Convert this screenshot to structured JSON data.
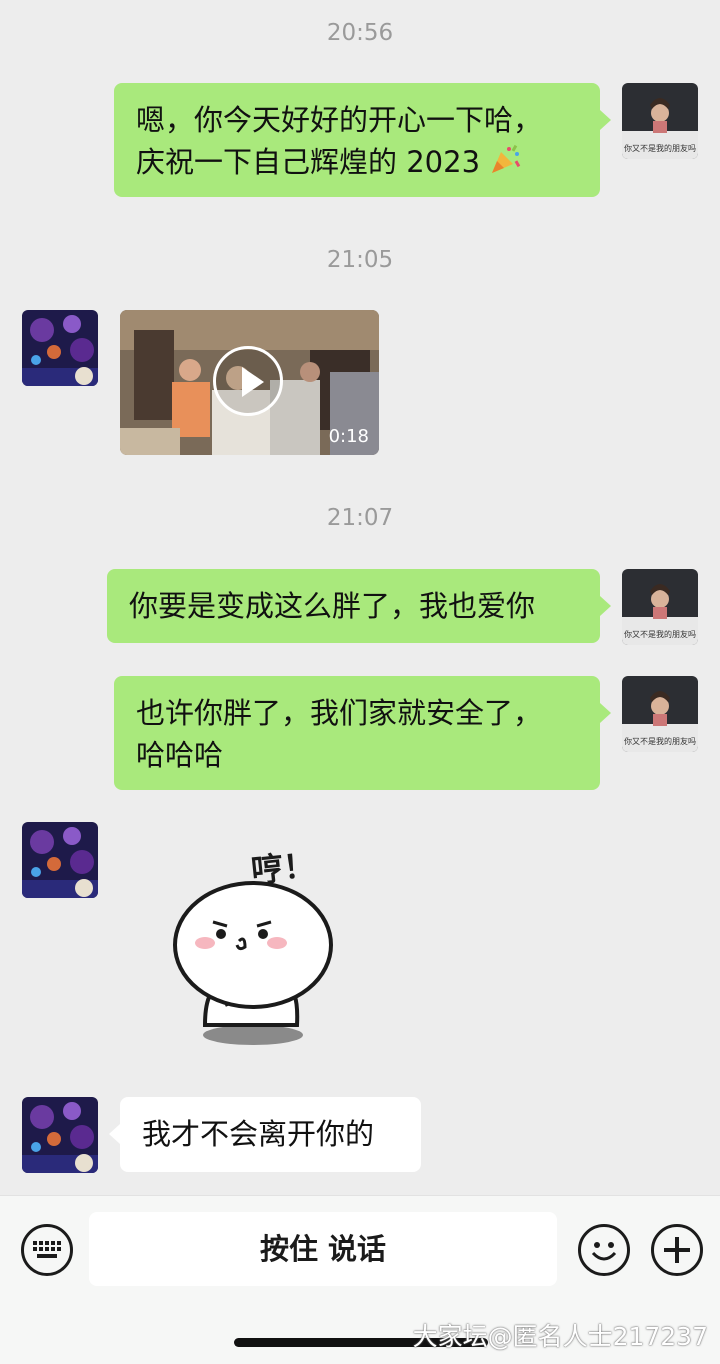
{
  "chat": {
    "messages": [
      {
        "type": "timestamp",
        "text": "20:56"
      },
      {
        "type": "text",
        "side": "right",
        "text_line1": "嗯，你今天好好的开心一下哈，",
        "text_line2": "庆祝一下自己辉煌的 2023",
        "emoji": "party-popper-icon",
        "avatar": "avatar-me"
      },
      {
        "type": "timestamp",
        "text": "21:05"
      },
      {
        "type": "video",
        "side": "left",
        "duration": "0:18",
        "avatar": "avatar-friend"
      },
      {
        "type": "timestamp",
        "text": "21:07"
      },
      {
        "type": "text",
        "side": "right",
        "text": "你要是变成这么胖了，我也爱你",
        "avatar": "avatar-me"
      },
      {
        "type": "text",
        "side": "right",
        "text_line1": "也许你胖了，我们家就安全了，",
        "text_line2": "哈哈哈",
        "avatar": "avatar-me"
      },
      {
        "type": "sticker",
        "side": "left",
        "sticker_text": "哼！",
        "avatar": "avatar-friend"
      },
      {
        "type": "text",
        "side": "left",
        "text": "我才不会离开你的",
        "avatar": "avatar-friend"
      }
    ],
    "avatar_me_caption": "你又不是我的朋友吗"
  },
  "input_bar": {
    "keyboard_icon": "keyboard-icon",
    "voice_label": "按住 说话",
    "emoji_icon": "smile-icon",
    "plus_icon": "plus-icon"
  },
  "watermark": "大家坛@匿名人士217237",
  "colors": {
    "bubble_green": "#a9e97c",
    "background": "#ededed",
    "bubble_white": "#ffffff"
  }
}
